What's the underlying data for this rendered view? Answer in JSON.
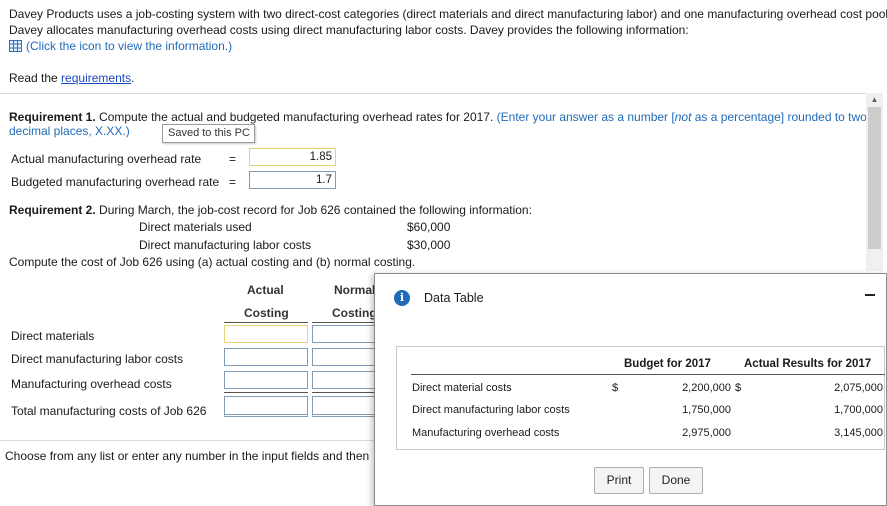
{
  "intro": {
    "line1": "Davey Products uses a job-costing system with two direct-cost categories (direct materials and direct manufacturing labor) and one manufacturing overhead cost pool.",
    "line2": "Davey allocates manufacturing overhead costs using direct manufacturing labor costs. Davey provides the following information:",
    "click_text": "(Click the icon to view the information.)",
    "read_prefix": "Read the ",
    "requirements_link": "requirements",
    "read_suffix": "."
  },
  "req1": {
    "bold": "Requirement 1.",
    "text": " Compute the actual and budgeted manufacturing overhead rates for 2017. ",
    "hint1": "(Enter your answer as a number [",
    "hint_not": "not",
    "hint2": " as a percentage] rounded to two",
    "hint_line2": "decimal places, X.XX.)",
    "tooltip": "Saved to this PC",
    "rows": [
      {
        "label": "Actual manufacturing overhead rate",
        "eq": "=",
        "value": "1.85"
      },
      {
        "label": "Budgeted manufacturing overhead rate",
        "eq": "=",
        "value": "1.7"
      }
    ]
  },
  "req2": {
    "bold": "Requirement 2.",
    "text": " During March, the job-cost record for Job 626 contained the following information:",
    "items": [
      {
        "label": "Direct materials used",
        "value": "$60,000"
      },
      {
        "label": "Direct manufacturing labor costs",
        "value": "$30,000"
      }
    ],
    "compute": "Compute the cost of Job 626 using (a) actual costing and (b) normal costing.",
    "col1_top": "Actual",
    "col1_bottom": "Costing",
    "col2_top": "Normal",
    "col2_bottom": "Costing",
    "rows": [
      "Direct materials",
      "Direct manufacturing labor costs",
      "Manufacturing overhead costs",
      "Total manufacturing costs of Job 626"
    ]
  },
  "footer": "Choose from any list or enter any number in the input fields and then continue to the next question.",
  "modal": {
    "title": "Data Table",
    "info_glyph": "i",
    "col_budget": "Budget for 2017",
    "col_actual": "Actual Results for 2017",
    "rows": [
      {
        "label": "Direct material costs",
        "cur1": "$",
        "budget": "2,200,000",
        "cur2": "$",
        "actual": "2,075,000"
      },
      {
        "label": "Direct manufacturing labor costs",
        "cur1": "",
        "budget": "1,750,000",
        "cur2": "",
        "actual": "1,700,000"
      },
      {
        "label": "Manufacturing overhead costs",
        "cur1": "",
        "budget": "2,975,000",
        "cur2": "",
        "actual": "3,145,000"
      }
    ],
    "print_label": "Print",
    "done_label": "Done"
  },
  "colors": {
    "link": "#1b49c4",
    "hint": "#1f6bb8",
    "input_border": "#7f9db9",
    "highlight_border": "#e6d27a"
  },
  "icons": {
    "table": "table-grid-icon",
    "info": "info-icon",
    "minimize": "minimize-icon",
    "scroll_up": "chevron-up-icon"
  }
}
